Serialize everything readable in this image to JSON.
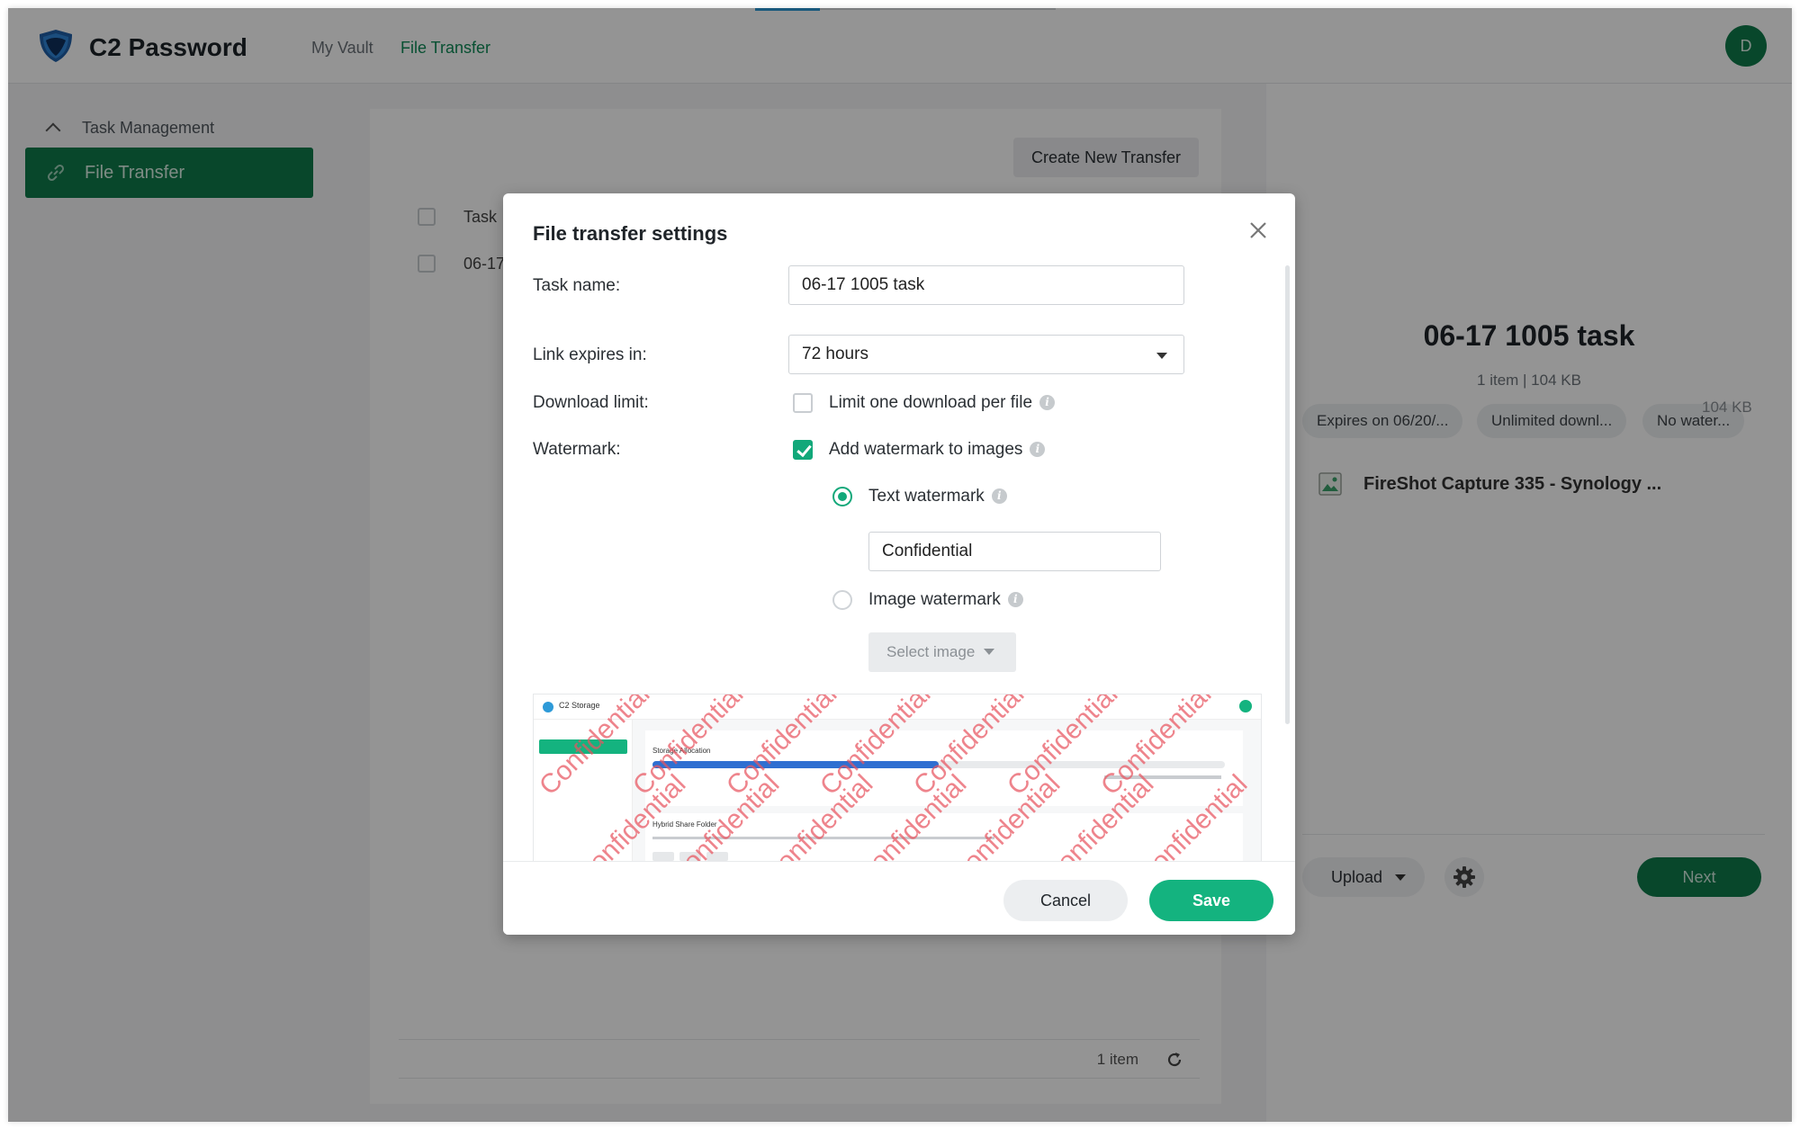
{
  "header": {
    "app_title": "C2 Password",
    "nav": {
      "vault": "My Vault",
      "file_transfer": "File Transfer"
    },
    "avatar_initial": "D"
  },
  "sidebar": {
    "group_label": "Task Management",
    "active_item": "File Transfer"
  },
  "list": {
    "create_button": "Create New Transfer",
    "column_task": "Task",
    "row_task": "06-17",
    "footer_count": "1 item"
  },
  "detail": {
    "title": "06-17 1005 task",
    "subtitle": "1 item | 104 KB",
    "chips": [
      "Expires on 06/20/...",
      "Unlimited downl...",
      "No water..."
    ],
    "file_name": "FireShot Capture 335 - Synology ...",
    "file_size": "104 KB",
    "upload_label": "Upload",
    "next_label": "Next"
  },
  "modal": {
    "title": "File transfer settings",
    "task_name_label": "Task name:",
    "task_name_value": "06-17 1005 task",
    "expires_label": "Link expires in:",
    "expires_value": "72 hours",
    "download_limit_label": "Download limit:",
    "download_limit_option": "Limit one download per file",
    "download_limit_checked": false,
    "watermark_label": "Watermark:",
    "watermark_option": "Add watermark to images",
    "watermark_checked": true,
    "text_watermark_label": "Text watermark",
    "text_watermark_value": "Confidential",
    "image_watermark_label": "Image watermark",
    "select_image_label": "Select image",
    "cancel_label": "Cancel",
    "save_label": "Save"
  },
  "preview": {
    "app_name": "C2 Storage",
    "watermark_text": "Confidential",
    "storage_heading": "Storage Allocation",
    "section_heading": "Hybrid Share Folder",
    "usage_fraction": 0.5
  },
  "colors": {
    "brand_green": "#0f7a4b",
    "accent_green": "#14b37f",
    "watermark_red": "#e85460",
    "link_blue": "#2e9ad8"
  },
  "icons": {
    "logo": "shield-icon",
    "close": "close-icon",
    "info": "info-icon",
    "refresh": "refresh-icon",
    "settings": "gear-icon",
    "file": "image-file-icon",
    "link": "link-icon"
  }
}
